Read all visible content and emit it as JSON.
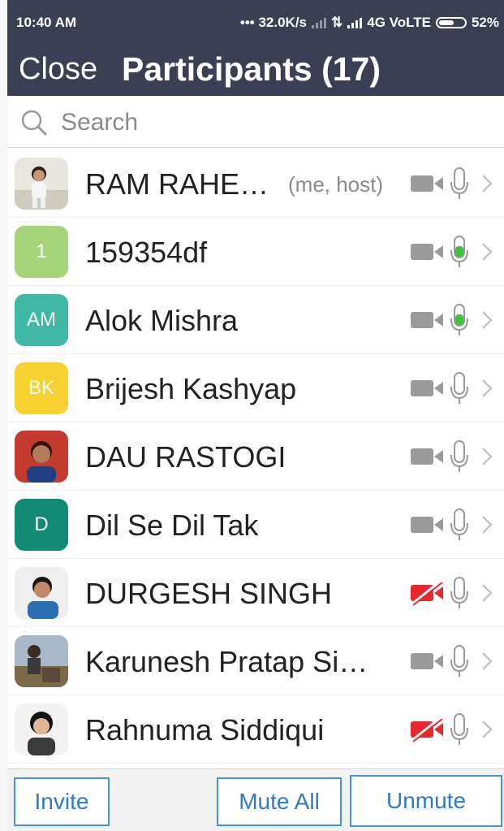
{
  "status_bar": {
    "time": "10:40 AM",
    "speed": "••• 32.0K/s",
    "network": "4G VoLTE",
    "battery": "52%"
  },
  "header": {
    "close_label": "Close",
    "title": "Participants (17)"
  },
  "search": {
    "placeholder": "Search"
  },
  "participants": [
    {
      "name": "RAM RAHE…",
      "tag": "(me, host)",
      "avatar_type": "photo",
      "video_on": true,
      "mic_active": false
    },
    {
      "name": "159354df",
      "avatar_initials": "1",
      "avatar_color": "#a6d47a",
      "video_on": true,
      "mic_active": true
    },
    {
      "name": "Alok Mishra",
      "avatar_initials": "AM",
      "avatar_color": "#3fb8a6",
      "video_on": true,
      "mic_active": true
    },
    {
      "name": "Brijesh Kashyap",
      "avatar_initials": "BK",
      "avatar_color": "#f7d12f",
      "video_on": true,
      "mic_active": false
    },
    {
      "name": "DAU RASTOGI",
      "avatar_type": "photo",
      "video_on": true,
      "mic_active": false
    },
    {
      "name": "Dil Se Dil Tak",
      "avatar_initials": "D",
      "avatar_color": "#128a74",
      "video_on": true,
      "mic_active": false
    },
    {
      "name": "DURGESH SINGH",
      "avatar_type": "photo",
      "video_on": false,
      "mic_active": false
    },
    {
      "name": "Karunesh Pratap Si…",
      "avatar_type": "photo",
      "video_on": true,
      "mic_active": false
    },
    {
      "name": "Rahnuma Siddiqui",
      "avatar_type": "photo",
      "video_on": false,
      "mic_active": false
    }
  ],
  "footer": {
    "invite_label": "Invite",
    "mute_all_label": "Mute All",
    "unmute_label": "Unmute"
  },
  "colors": {
    "header_bg": "#3a3f54",
    "mic_active": "#3cc43c",
    "icon_gray": "#9a9a9a",
    "video_off": "#e8282e",
    "button_blue": "#4a90d6"
  }
}
